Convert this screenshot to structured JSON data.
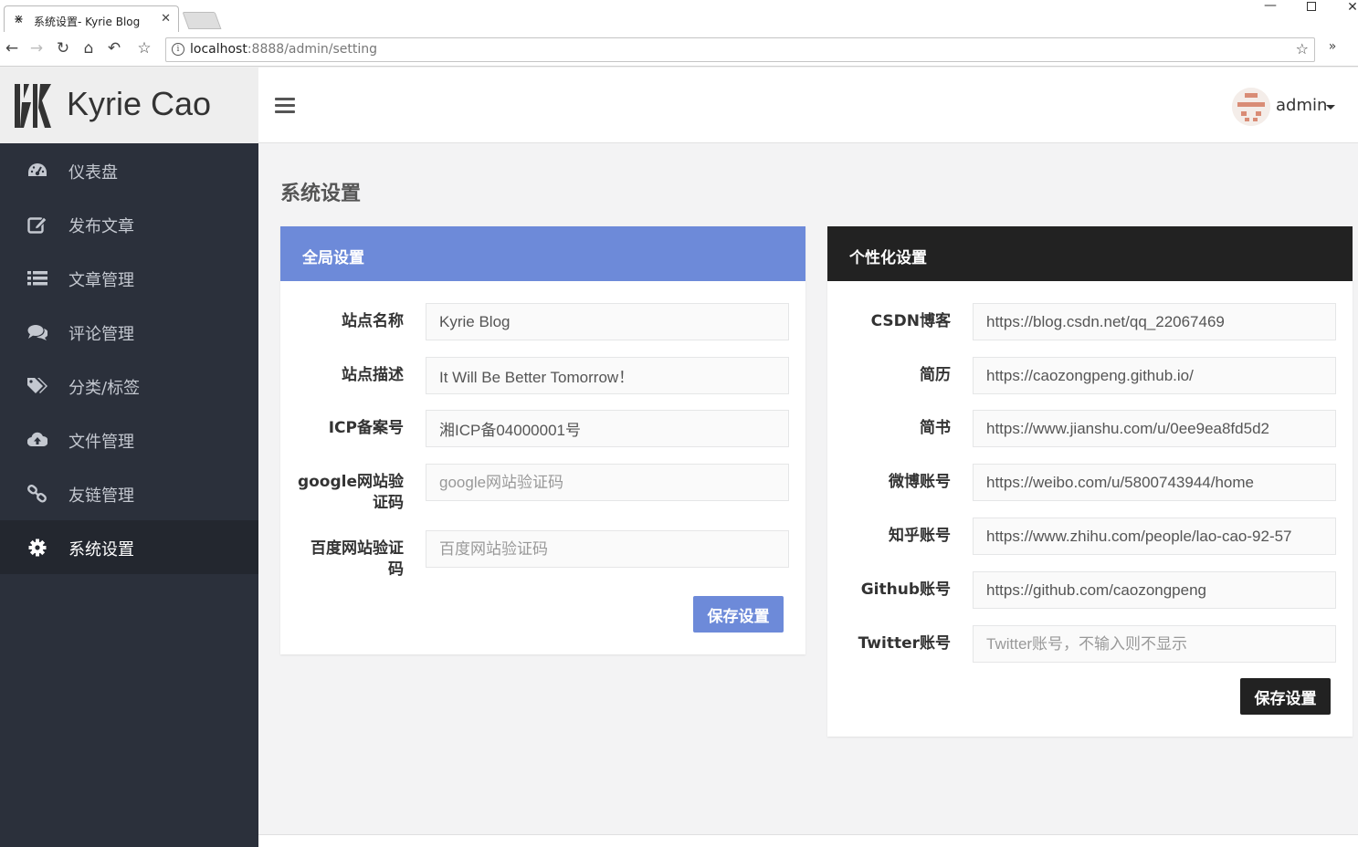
{
  "browser": {
    "tab_title": "系统设置- Kyrie Blog",
    "url_host": "localhost",
    "url_path": ":8888/admin/setting"
  },
  "brand": {
    "name": "Kyrie Cao"
  },
  "sidebar": {
    "items": [
      {
        "label": "仪表盘",
        "icon": "dashboard-icon"
      },
      {
        "label": "发布文章",
        "icon": "edit-icon"
      },
      {
        "label": "文章管理",
        "icon": "list-icon"
      },
      {
        "label": "评论管理",
        "icon": "comments-icon"
      },
      {
        "label": "分类/标签",
        "icon": "tags-icon"
      },
      {
        "label": "文件管理",
        "icon": "cloud-upload-icon"
      },
      {
        "label": "友链管理",
        "icon": "link-icon"
      },
      {
        "label": "系统设置",
        "icon": "gear-icon",
        "active": true
      }
    ]
  },
  "topbar": {
    "user": "admin"
  },
  "page": {
    "title": "系统设置"
  },
  "global_settings": {
    "title": "全局设置",
    "fields": {
      "site_name": {
        "label": "站点名称",
        "value": "Kyrie Blog",
        "placeholder": ""
      },
      "site_desc": {
        "label": "站点描述",
        "value": "It Will Be Better Tomorrow！",
        "placeholder": ""
      },
      "icp": {
        "label": "ICP备案号",
        "value": "湘ICP备04000001号",
        "placeholder": ""
      },
      "google_verify": {
        "label_line1": "google网站验",
        "label_line2": "证码",
        "value": "",
        "placeholder": "google网站验证码"
      },
      "baidu_verify": {
        "label_line1": "百度网站验证",
        "label_line2": "码",
        "value": "",
        "placeholder": "百度网站验证码"
      }
    },
    "save_label": "保存设置"
  },
  "personal_settings": {
    "title": "个性化设置",
    "fields": {
      "csdn": {
        "label": "CSDN博客",
        "value": "https://blog.csdn.net/qq_22067469",
        "placeholder": ""
      },
      "resume": {
        "label": "简历",
        "value": "https://caozongpeng.github.io/",
        "placeholder": ""
      },
      "jianshu": {
        "label": "简书",
        "value": "https://www.jianshu.com/u/0ee9ea8fd5d2",
        "placeholder": ""
      },
      "weibo": {
        "label": "微博账号",
        "value": "https://weibo.com/u/5800743944/home",
        "placeholder": ""
      },
      "zhihu": {
        "label": "知乎账号",
        "value": "https://www.zhihu.com/people/lao-cao-92-57",
        "placeholder": ""
      },
      "github": {
        "label": "Github账号",
        "value": "https://github.com/caozongpeng",
        "placeholder": ""
      },
      "twitter": {
        "label": "Twitter账号",
        "value": "",
        "placeholder": "Twitter账号，不输入则不显示"
      }
    },
    "save_label": "保存设置"
  },
  "colors": {
    "sidebar_bg": "#2b303b",
    "accent_blue": "#6d8ad9",
    "dark": "#222222"
  }
}
